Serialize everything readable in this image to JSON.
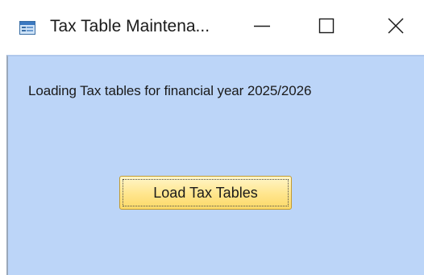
{
  "window": {
    "title": "Tax Table Maintena...",
    "icon": "window-app-icon",
    "controls": {
      "minimize_icon": "minimize-icon",
      "maximize_icon": "maximize-icon",
      "close_icon": "close-icon"
    }
  },
  "content": {
    "loading_text": "Loading Tax tables for financial year 2025/2026",
    "load_button_label": "Load Tax Tables"
  },
  "colors": {
    "client_background": "#bcd5f8",
    "button_fill": "#ffe58c",
    "button_border": "#c29b32"
  }
}
